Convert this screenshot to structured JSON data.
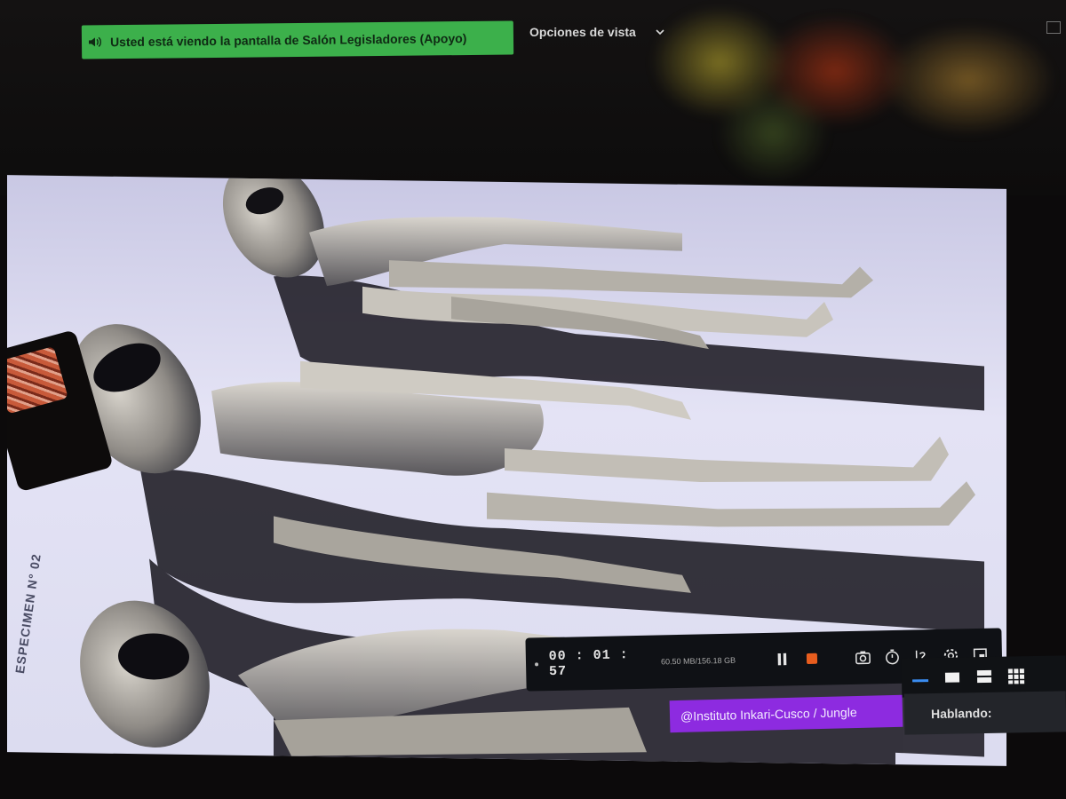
{
  "banner": {
    "text": "Usted está viendo la pantalla de  Salón Legisladores (Apoyo)",
    "icon": "speaker-icon"
  },
  "view_options": {
    "label": "Opciones de vista",
    "icon": "chevron-down-icon"
  },
  "shared_content": {
    "label_cards": [
      "ESPECIMEN N° 02"
    ],
    "credit": "@Instituto Inkari-Cusco / Jungle"
  },
  "recording_toolbar": {
    "timer": "00 : 01 : 57",
    "file_size": "60.50 MB/156.18 GB",
    "icons": [
      "pause-icon",
      "stop-icon",
      "screenshot-icon",
      "timer-icon",
      "draw-icon",
      "settings-icon",
      "window-icon"
    ]
  },
  "layout_options": [
    "speaker-layout-icon",
    "single-layout-icon",
    "split-layout-icon",
    "gallery-layout-icon"
  ],
  "speaking_panel": {
    "label": "Hablando:"
  },
  "colors": {
    "banner_bg": "#3cb04b",
    "credit_bg": "#8d2be0",
    "stop_color": "#e85d1e",
    "toolbar_bg": "#0f1115"
  }
}
